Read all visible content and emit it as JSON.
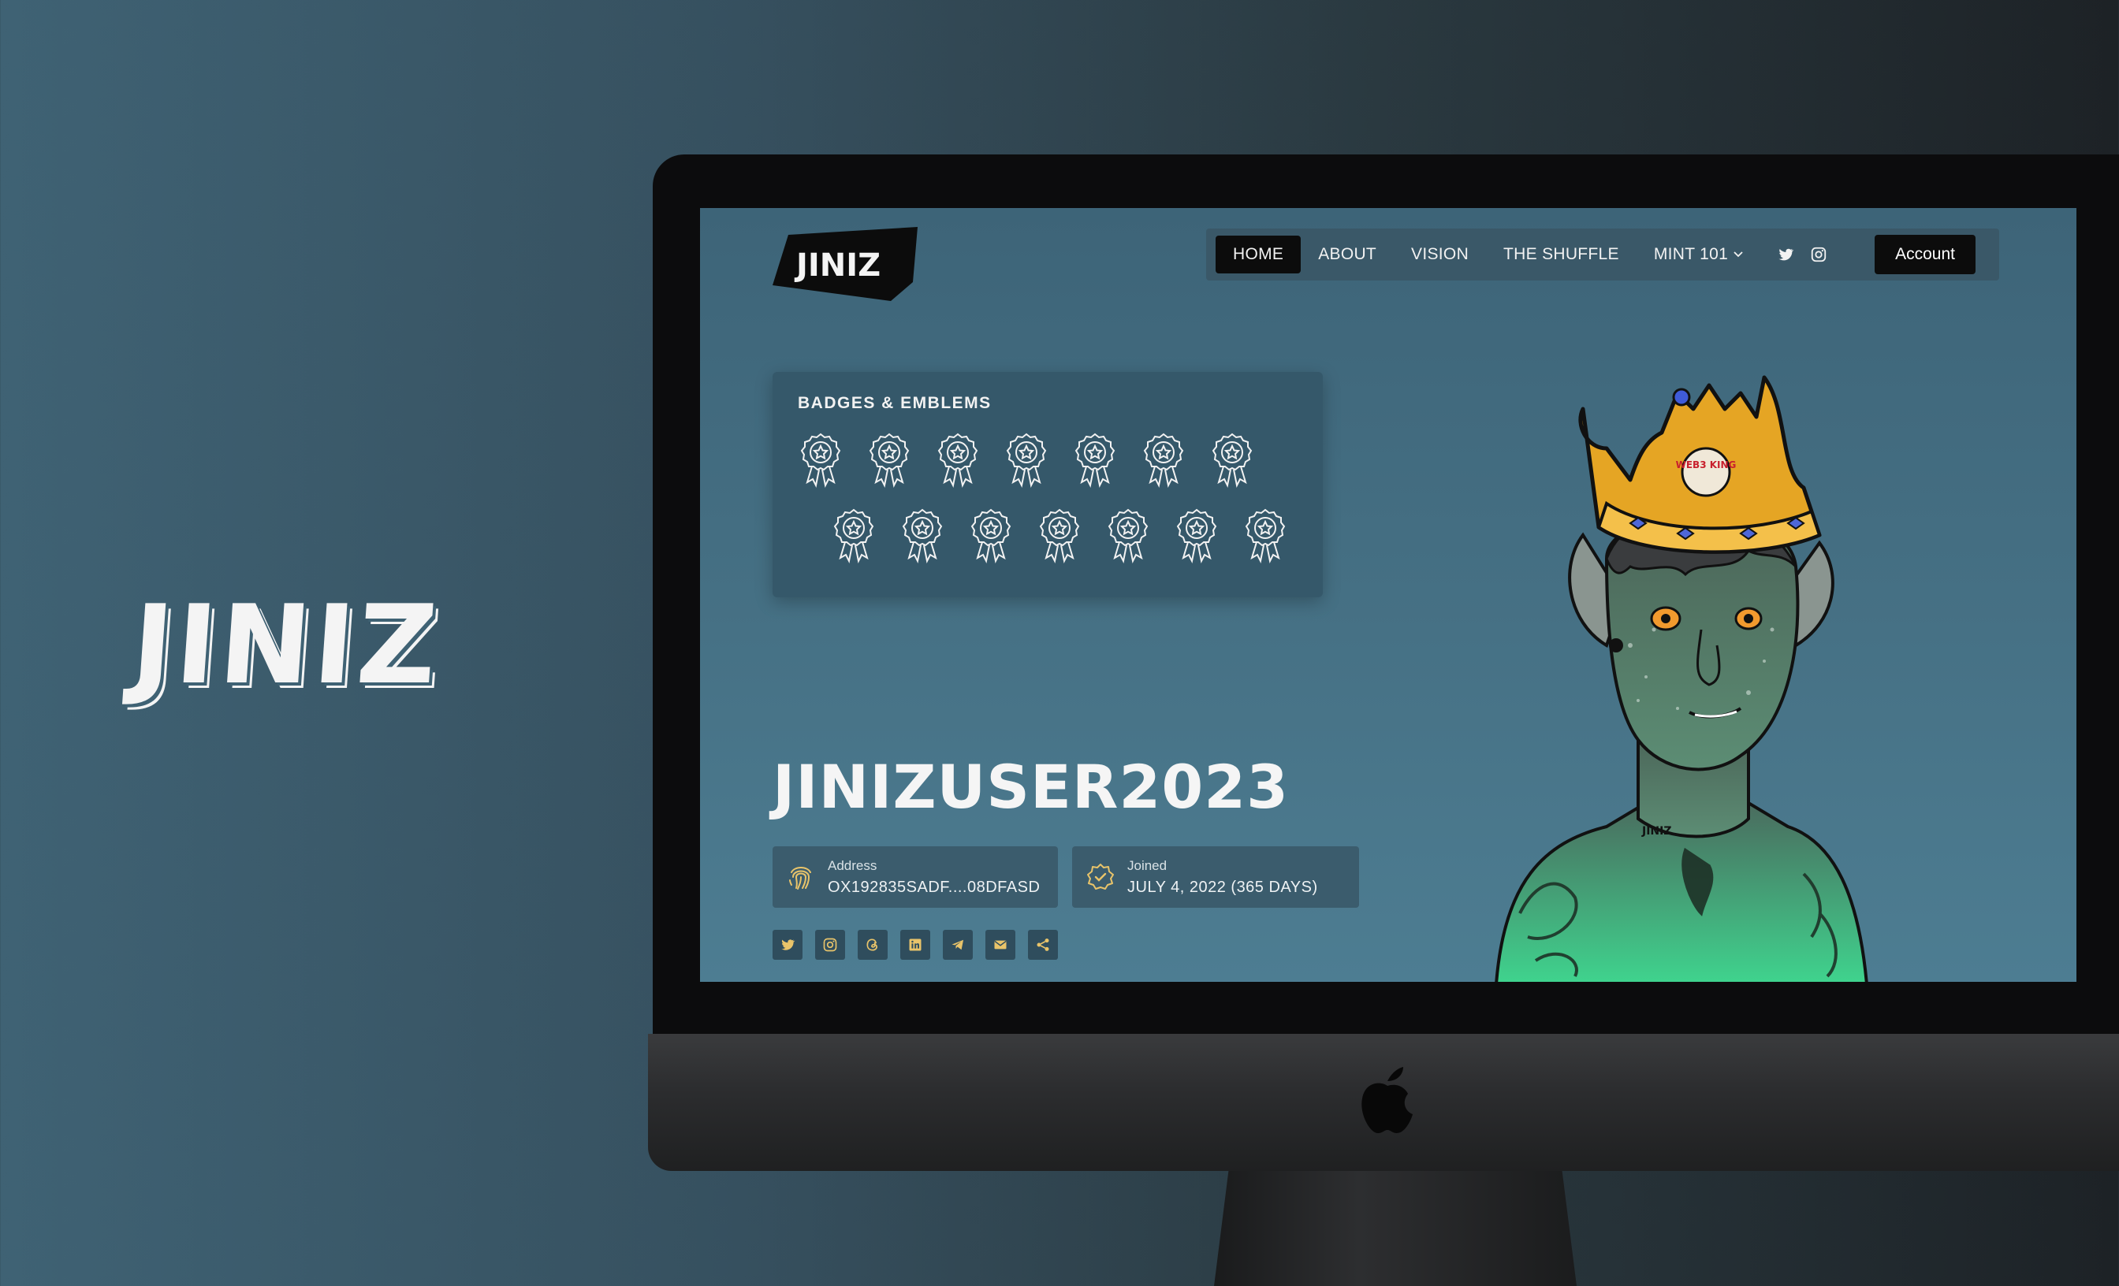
{
  "brand": {
    "hero_logo": "JINIZ",
    "site_logo": "JINIZ"
  },
  "nav": {
    "items": [
      {
        "label": "HOME",
        "active": true
      },
      {
        "label": "ABOUT"
      },
      {
        "label": "VISION"
      },
      {
        "label": "THE SHUFFLE"
      },
      {
        "label": "MINT 101"
      }
    ],
    "social_icons": [
      "twitter-icon",
      "instagram-icon"
    ],
    "account_label": "Account"
  },
  "badges": {
    "title": "BADGES & EMBLEMS",
    "row1_count": 7,
    "row2_count": 7,
    "icon": "award-ribbon-icon"
  },
  "profile": {
    "username": "JINIZUSER2023",
    "address": {
      "label": "Address",
      "value": "OX192835SADF....08DFASD",
      "icon": "fingerprint-icon"
    },
    "joined": {
      "label": "Joined",
      "value": "JULY 4, 2022 (365 DAYS)",
      "icon": "verified-check-icon"
    },
    "social_links": [
      "twitter-icon",
      "instagram-icon",
      "threads-icon",
      "linkedin-icon",
      "telegram-icon",
      "mail-icon",
      "share-icon"
    ]
  },
  "avatar": {
    "crown_text": "WEB3 KING",
    "chest_text": "JINIZ"
  },
  "colors": {
    "accent": "#e9c46a",
    "nav_bg": "#3a5868",
    "panel_bg": "#35586a",
    "button_dark": "#0c0c0c"
  }
}
